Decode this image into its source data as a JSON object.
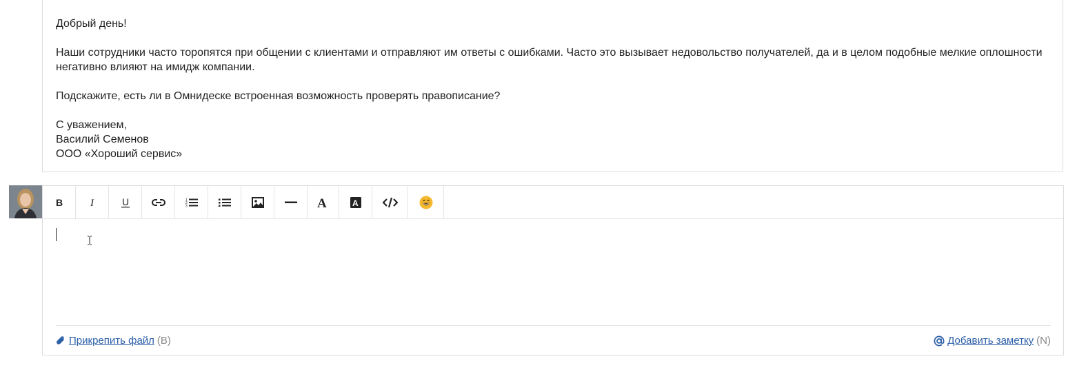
{
  "message": {
    "greeting": "Добрый день!",
    "paragraph1": "Наши сотрудники часто торопятся при общении с клиентами и отправляют им ответы с ошибками. Часто это вызывает недовольство получателей, да и в целом подобные мелкие оплошности негативно влияют на имидж компании.",
    "paragraph2": "Подскажите, есть ли в Омнидеске встроенная возможность проверять правописание?",
    "closing": "С уважением,",
    "sender_name": "Василий Семенов",
    "sender_company": "ООО «Хороший сервис»"
  },
  "toolbar": {
    "buttons": [
      {
        "name": "bold",
        "icon": "bold-icon"
      },
      {
        "name": "italic",
        "icon": "italic-icon"
      },
      {
        "name": "underline",
        "icon": "underline-icon"
      },
      {
        "name": "link",
        "icon": "link-icon"
      },
      {
        "name": "ordered-list",
        "icon": "ordered-list-icon"
      },
      {
        "name": "bullet-list",
        "icon": "bullet-list-icon"
      },
      {
        "name": "image",
        "icon": "image-icon"
      },
      {
        "name": "horizontal-rule",
        "icon": "horizontal-rule-icon"
      },
      {
        "name": "text-color",
        "icon": "text-color-icon"
      },
      {
        "name": "background-color",
        "icon": "background-color-icon"
      },
      {
        "name": "code",
        "icon": "code-icon"
      },
      {
        "name": "emoji",
        "icon": "emoji-icon"
      }
    ]
  },
  "editor": {
    "value": ""
  },
  "footer": {
    "attach_label": "Прикрепить файл",
    "attach_hint": "(B)",
    "note_label": "Добавить заметку",
    "note_hint": "(N)"
  },
  "colors": {
    "link": "#2a5ea8",
    "border": "#dcdcdc",
    "hint": "#888888"
  }
}
